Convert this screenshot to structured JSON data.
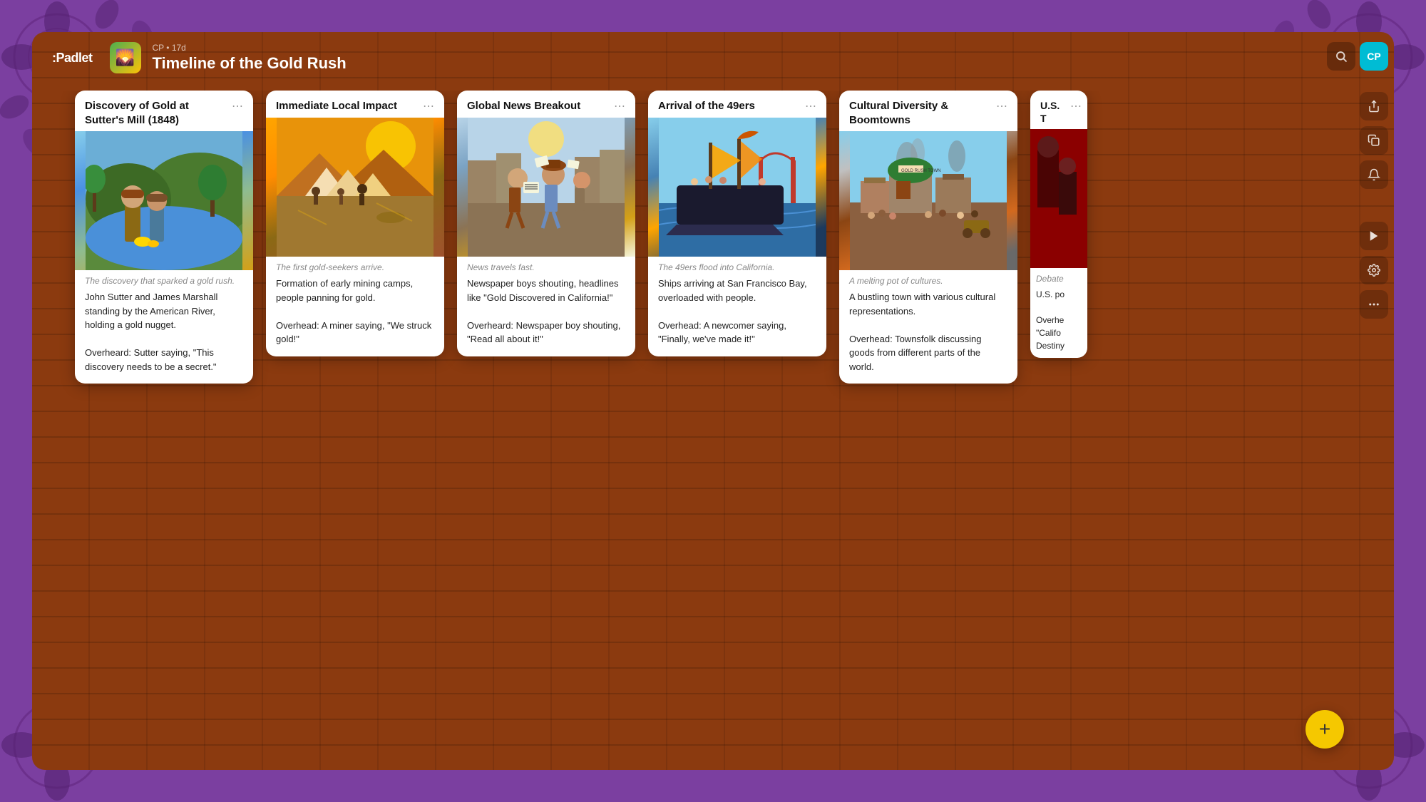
{
  "app": {
    "logo": ":Padlet"
  },
  "header": {
    "board_meta": "CP • 17d",
    "board_title": "Timeline of the Gold Rush",
    "board_icon_emoji": "🌄"
  },
  "search": {
    "placeholder": "Search"
  },
  "toolbar": {
    "share_icon": "↗",
    "duplicate_icon": "⊡",
    "bell_icon": "🔔",
    "play_icon": "▶",
    "settings_icon": "⚙",
    "more_icon": "···",
    "avatar_label": "CP"
  },
  "cards": [
    {
      "id": "card-1",
      "title": "Discovery of Gold at Sutter's Mill (1848)",
      "menu_label": "⋯",
      "image_style": "img-gold-rush",
      "image_emoji": "⛏️",
      "subtitle": "The discovery that sparked a gold rush.",
      "body": "John Sutter and James Marshall standing by the American River, holding a gold nugget.\n\nOverheard: Sutter saying, \"This discovery needs to be a secret.\""
    },
    {
      "id": "card-2",
      "title": "Immediate Local Impact",
      "menu_label": "⋯",
      "image_style": "img-mining-camp",
      "image_emoji": "⛺",
      "subtitle": "The first gold-seekers arrive.",
      "body": "Formation of early mining camps, people panning for gold.\n\nOverhead: A miner saying, \"We struck gold!\""
    },
    {
      "id": "card-3",
      "title": "Global News Breakout",
      "menu_label": "⋯",
      "image_style": "img-news",
      "image_emoji": "📰",
      "subtitle": "News travels fast.",
      "body": "Newspaper boys shouting, headlines like \"Gold Discovered in California!\"\n\nOverheard: Newspaper boy shouting, \"Read all about it!\""
    },
    {
      "id": "card-4",
      "title": "Arrival of the 49ers",
      "menu_label": "⋯",
      "image_style": "img-ship",
      "image_emoji": "⛵",
      "subtitle": "The 49ers flood into California.",
      "body": "Ships arriving at San Francisco Bay, overloaded with people.\n\nOverhead: A newcomer saying, \"Finally, we've made it!\""
    },
    {
      "id": "card-5",
      "title": "Cultural Diversity & Boomtowns",
      "menu_label": "⋯",
      "image_style": "img-boomtown",
      "image_emoji": "🏙️",
      "subtitle": "A melting pot of cultures.",
      "body": "A bustling town with various cultural representations.\n\nOverhead: Townsfolk discussing goods from different parts of the world."
    },
    {
      "id": "card-6",
      "title": "U.S. T",
      "menu_label": "⋯",
      "image_style": "img-debate",
      "image_emoji": "🎙️",
      "subtitle": "Debate",
      "body": "U.S. po\n\nOverhe\n\"Califo\nDestiny"
    }
  ],
  "add_button_label": "+",
  "colors": {
    "brick_bg": "#8B3A0F",
    "purple_border": "#7B3FA0",
    "card_bg": "#ffffff",
    "add_btn": "#F5C800"
  }
}
